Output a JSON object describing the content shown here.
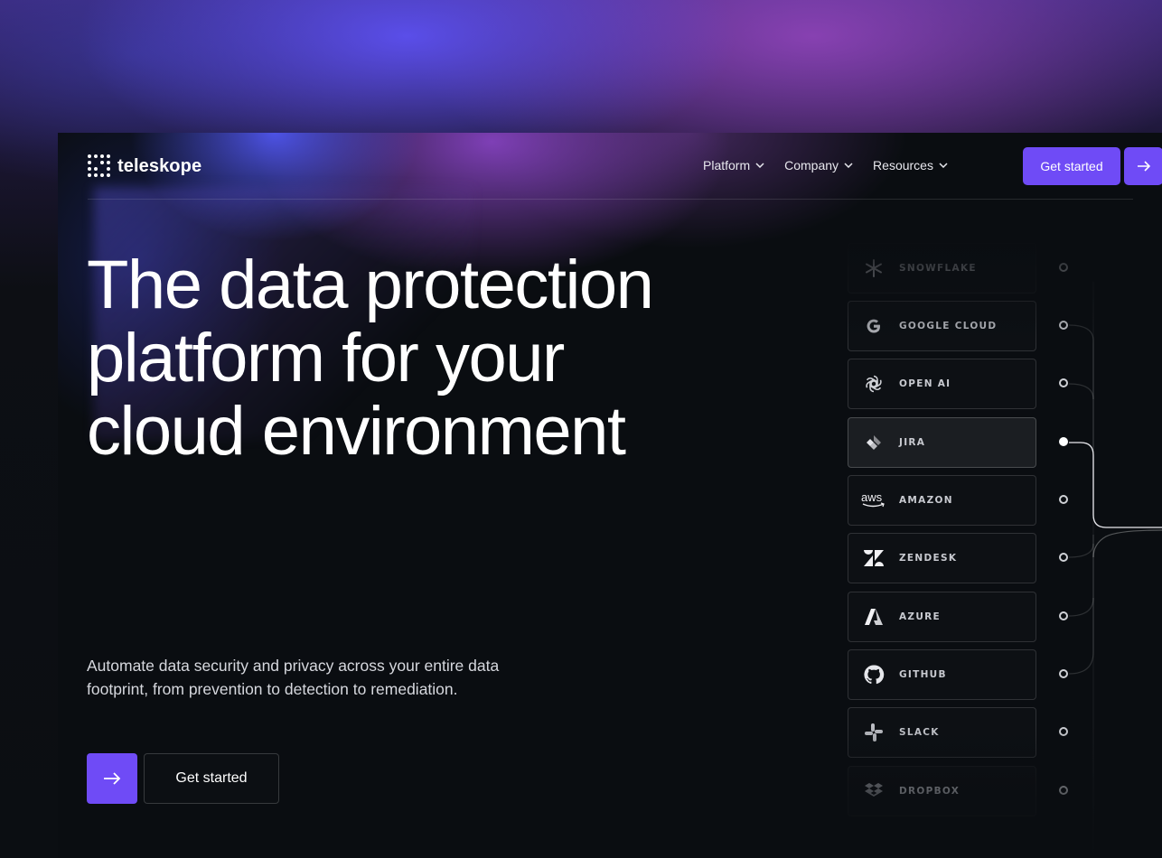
{
  "brand": {
    "name": "teleskope"
  },
  "nav": {
    "items": [
      {
        "label": "Platform"
      },
      {
        "label": "Company"
      },
      {
        "label": "Resources"
      }
    ],
    "cta_label": "Get started"
  },
  "hero": {
    "title_lines": [
      "The data protection",
      "platform for your",
      "cloud environment"
    ],
    "subtitle": "Automate data security and privacy across your entire data footprint, from prevention to detection to remediation.",
    "cta_label": "Get started"
  },
  "integrations": [
    {
      "label": "SNOWFLAKE",
      "icon": "snowflake-icon"
    },
    {
      "label": "GOOGLE CLOUD",
      "icon": "google-icon"
    },
    {
      "label": "OPEN AI",
      "icon": "openai-icon"
    },
    {
      "label": "JIRA",
      "icon": "jira-icon",
      "active": true
    },
    {
      "label": "AMAZON",
      "icon": "aws-icon"
    },
    {
      "label": "ZENDESK",
      "icon": "zendesk-icon"
    },
    {
      "label": "AZURE",
      "icon": "azure-icon"
    },
    {
      "label": "GITHUB",
      "icon": "github-icon"
    },
    {
      "label": "SLACK",
      "icon": "slack-icon"
    },
    {
      "label": "DROPBOX",
      "icon": "dropbox-icon"
    }
  ],
  "colors": {
    "accent": "#6f4bf6",
    "background": "#0a0d11"
  }
}
